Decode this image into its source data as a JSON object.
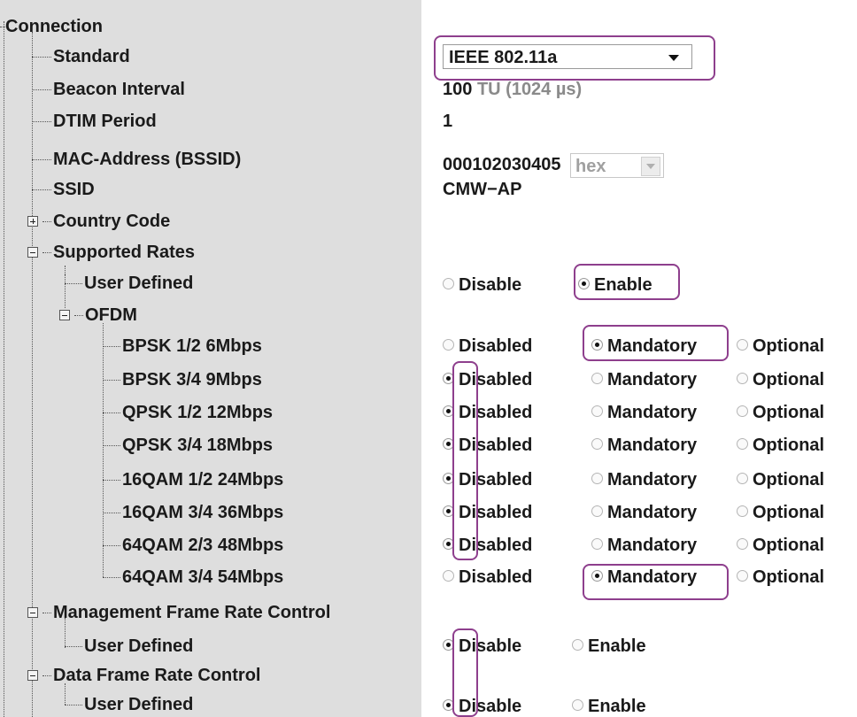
{
  "tree": {
    "connection": "Connection",
    "standard": "Standard",
    "beacon_interval": "Beacon Interval",
    "dtim_period": "DTIM Period",
    "mac_address": "MAC-Address (BSSID)",
    "ssid": "SSID",
    "country_code": "Country Code",
    "supported_rates": "Supported Rates",
    "user_defined": "User Defined",
    "ofdm": "OFDM",
    "rates": [
      "BPSK 1/2 6Mbps",
      "BPSK 3/4 9Mbps",
      "QPSK 1/2 12Mbps",
      "QPSK 3/4 18Mbps",
      "16QAM 1/2 24Mbps",
      "16QAM 3/4 36Mbps",
      "64QAM 2/3 48Mbps",
      "64QAM 3/4 54Mbps"
    ],
    "mgmt_frame_rate": "Management Frame Rate Control",
    "mgmt_user_defined": "User Defined",
    "data_frame_rate": "Data Frame Rate Control",
    "data_user_defined": "User Defined"
  },
  "values": {
    "standard_selected": "IEEE 802.11a",
    "beacon_value": "100",
    "beacon_unit": "TU (1024 µs)",
    "dtim_value": "1",
    "mac_value": "000102030405",
    "mac_format": "hex",
    "ssid_value": "CMW−AP"
  },
  "options": {
    "disable": "Disable",
    "enable": "Enable",
    "disabled": "Disabled",
    "mandatory": "Mandatory",
    "optional": "Optional"
  },
  "selection": {
    "supported_rates_user_defined": "Enable",
    "rates": [
      "Mandatory",
      "Disabled",
      "Disabled",
      "Disabled",
      "Disabled",
      "Disabled",
      "Disabled",
      "Mandatory"
    ],
    "mgmt_user_defined": "Disable",
    "data_user_defined": "Disable"
  },
  "colors": {
    "highlight": "#8e3f8d",
    "tree_bg": "#dedede",
    "unit_gray": "#8a8a8a"
  }
}
